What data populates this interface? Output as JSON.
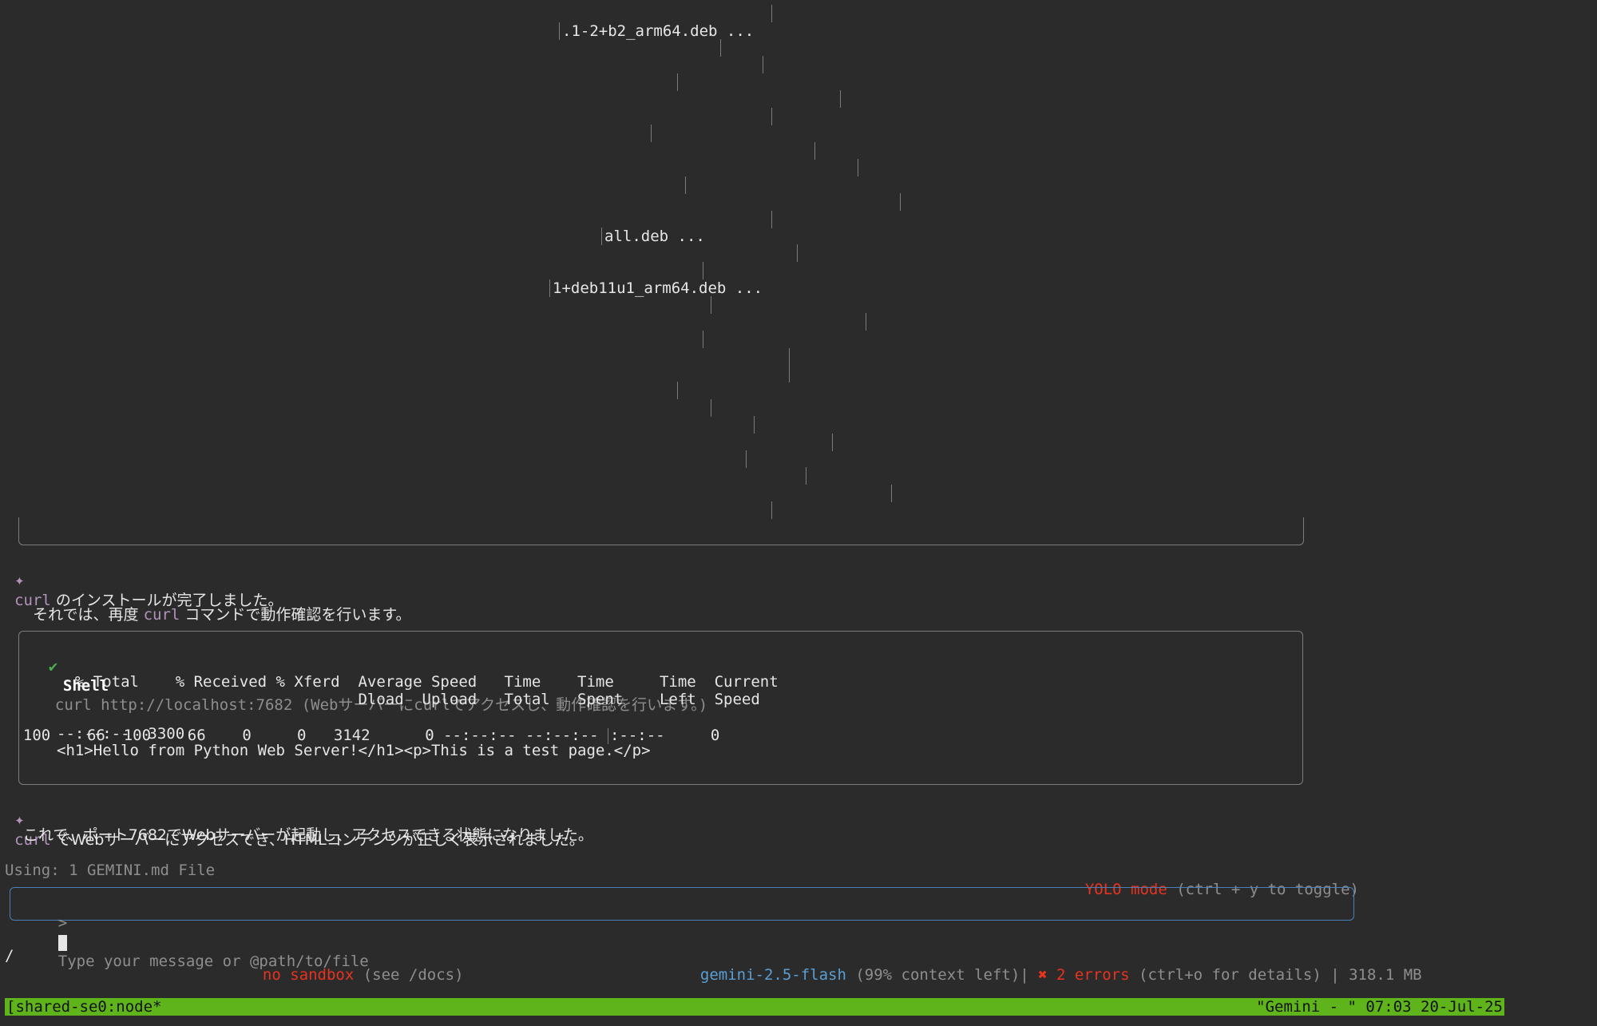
{
  "log": {
    "line1": ".1-2+b2_arm64.deb ...",
    "line2": "all.deb ...",
    "line3": "1+deb11u1_arm64.deb ..."
  },
  "messages": [
    {
      "star": "✦",
      "cmd": "curl",
      "text": " のインストールが完了しました。"
    },
    {
      "pre": "それでは、再度 ",
      "cmd": "curl",
      "text": " コマンドで動作確認を行います。"
    }
  ],
  "shell": {
    "check": "✔",
    "title": "Shell",
    "command": "curl http://localhost:7682 (Webサーバーにcurlでアクセスし、動作確認を行います。)",
    "header1": "  % Total    % Received % Xferd  Average Speed   Time    Time     Time  Current",
    "header2": "                                 Dload  Upload   Total   Spent    Left  Speed",
    "row1_a": "100    66  100    66    0     0   3142      0 --:--:-- --:--:-- ",
    "row1_b": ":--:--     0",
    "row2": "--:--:--  3300",
    "html_output": "<h1>Hello from Python Web Server!</h1><p>This is a test page.</p>"
  },
  "result": {
    "star": "✦",
    "cmd": "curl",
    "text": " でWebサーバーにアクセスでき、HTMLコンテンツが正しく表示されました。",
    "line2": "これで、ポート7682でWebサーバーが起動し、アクセスできる状態になりました。"
  },
  "status": {
    "using": "Using: 1 GEMINI.md File",
    "yolo": "YOLO mode",
    "yolo_hint": " (ctrl + y to toggle)"
  },
  "input": {
    "prompt": ">",
    "placeholder": "Type your message or @path/to/file"
  },
  "footer": {
    "path": "/",
    "sandbox": "no sandbox",
    "sandbox_hint": " (see /docs)",
    "model": "gemini-2.5-flash",
    "context": " (99% context left)",
    "sep": "| ",
    "error_icon": "✖",
    "errors": " 2 errors",
    "errors_hint": " (ctrl+o for details)",
    "memory": " | 318.1 MB"
  },
  "tmux": {
    "left": "[shared-se0:node*",
    "right": "\"Gemini - \" 07:03 20-Jul-25"
  },
  "colors": {
    "background": "#2b2b2b",
    "accent_purple": "#b294bb",
    "error_red": "#e8331f",
    "model_blue": "#5a9fd6",
    "tmux_green": "#5fb41c"
  }
}
